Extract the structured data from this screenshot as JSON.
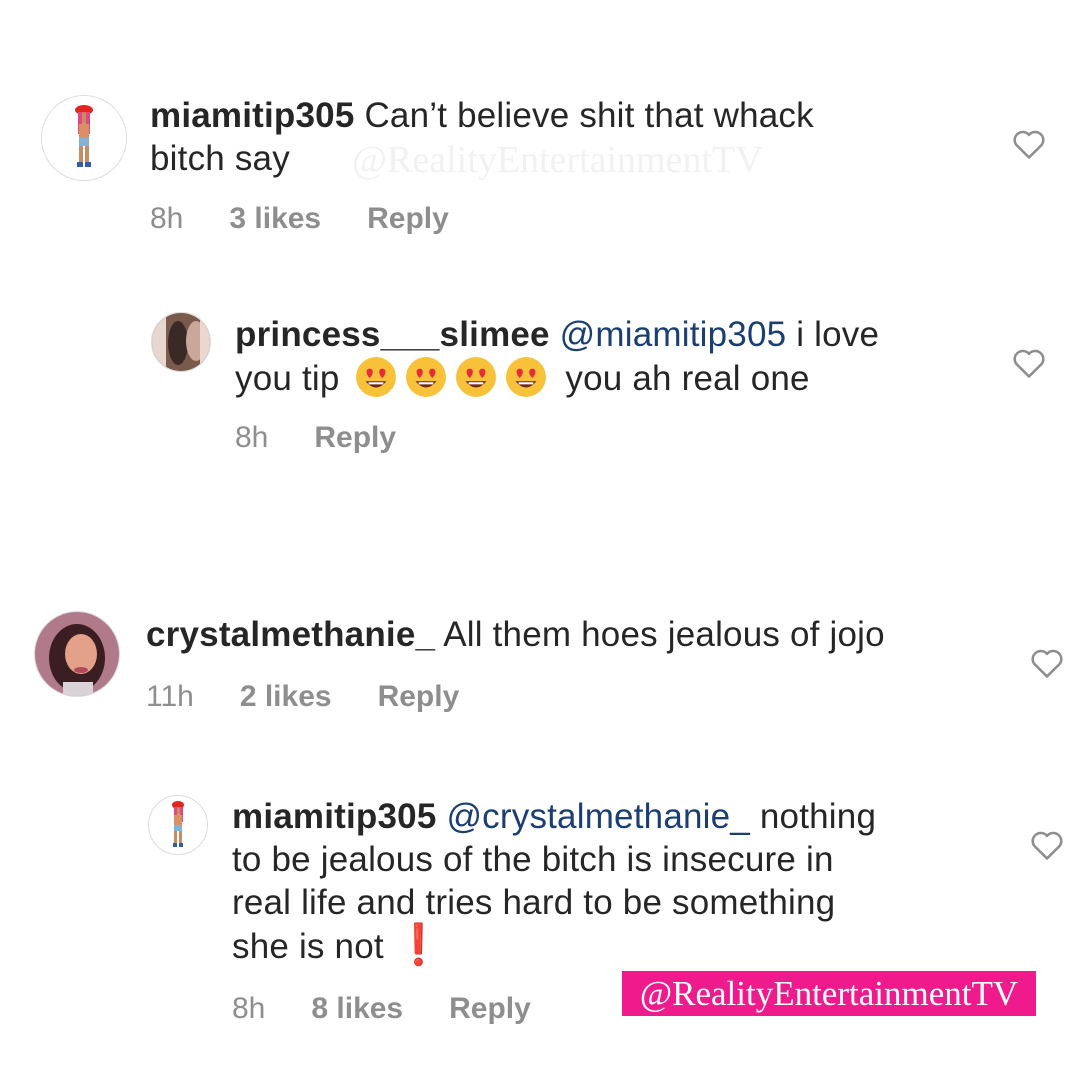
{
  "watermark": {
    "faint": "@RealityEntertainmentTV",
    "banner": "@RealityEntertainmentTV",
    "banner_color": "#ef1b8c"
  },
  "comments": [
    {
      "username": "miamitip305",
      "text_line1": "Can’t believe shit that whack",
      "text_line2": "bitch say",
      "time": "8h",
      "likes": "3 likes",
      "reply": "Reply",
      "heart_icon": "heart-outline-icon"
    },
    {
      "username": "princess___slimee",
      "mention": "@miamitip305",
      "text_line1": "i love",
      "text_line2_start": "you tip",
      "emojis": [
        "smiling-face-with-heart-eyes",
        "smiling-face-with-heart-eyes",
        "smiling-face-with-heart-eyes",
        "smiling-face-with-heart-eyes"
      ],
      "text_line2_end": "you ah real one",
      "time": "8h",
      "reply": "Reply",
      "heart_icon": "heart-outline-icon"
    },
    {
      "username": "crystalmethanie_",
      "text_line1": "All them hoes jealous of jojo",
      "time": "11h",
      "likes": "2 likes",
      "reply": "Reply",
      "heart_icon": "heart-outline-icon"
    },
    {
      "username": "miamitip305",
      "mention": "@crystalmethanie_",
      "text_line1": "nothing",
      "text_line2": "to be jealous of the bitch is insecure in",
      "text_line3": "real life and tries hard to be something",
      "text_line4": "she is not",
      "emphasis": "❗",
      "time": "8h",
      "likes": "8 likes",
      "reply": "Reply",
      "heart_icon": "heart-outline-icon"
    }
  ],
  "colors": {
    "text": "#262626",
    "meta": "#8e8e8e",
    "mention": "#1b3f73"
  }
}
